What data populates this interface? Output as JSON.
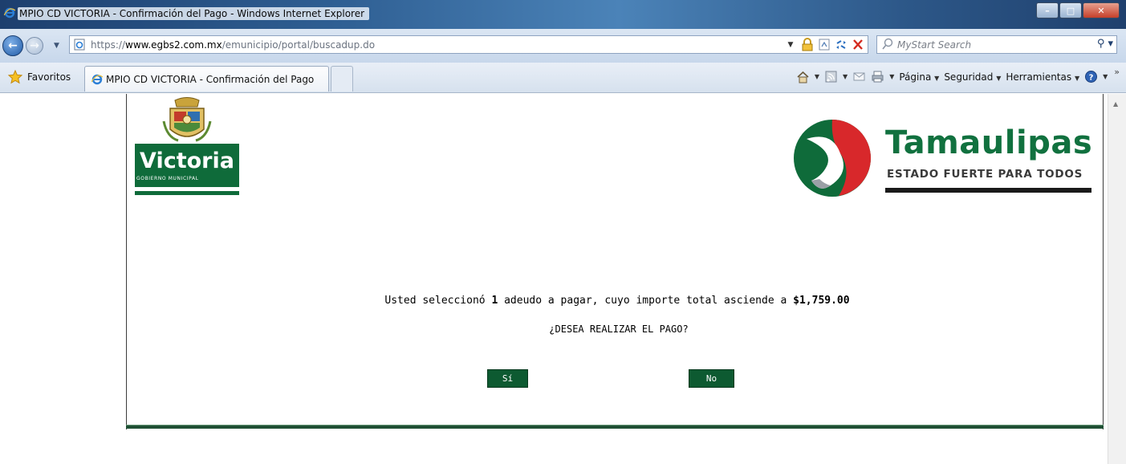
{
  "window": {
    "title": "MPIO CD VICTORIA - Confirmación del Pago - Windows Internet Explorer",
    "controls": [
      "minimize",
      "maximize",
      "close"
    ]
  },
  "address_bar": {
    "url_prefix": "https://",
    "url_domain": "www.egbs2.com.mx",
    "url_path": "/emunicipio/portal/buscadup.do",
    "search_placeholder": "MyStart Search"
  },
  "favorites_bar": {
    "favorites_label": "Favoritos",
    "tab_label": "MPIO CD VICTORIA - Confirmación del Pago",
    "commands": {
      "page": "Página",
      "security": "Seguridad",
      "tools": "Herramientas"
    }
  },
  "page": {
    "left_logo": {
      "name": "Victoria",
      "subtitle": "GOBIERNO MUNICIPAL"
    },
    "right_logo": {
      "name": "Tamaulipas",
      "tagline": "ESTADO FUERTE PARA TODOS"
    },
    "message": {
      "prefix": "Usted seleccionó ",
      "count": "1",
      "middle": " adeudo a pagar, cuyo importe total asciende a ",
      "amount": "$1,759.00"
    },
    "question": "¿DESEA REALIZAR EL PAGO?",
    "yes_label": "Sí",
    "no_label": "No"
  },
  "colors": {
    "brand_green": "#0f6b3a",
    "button_green": "#0d5a31"
  }
}
